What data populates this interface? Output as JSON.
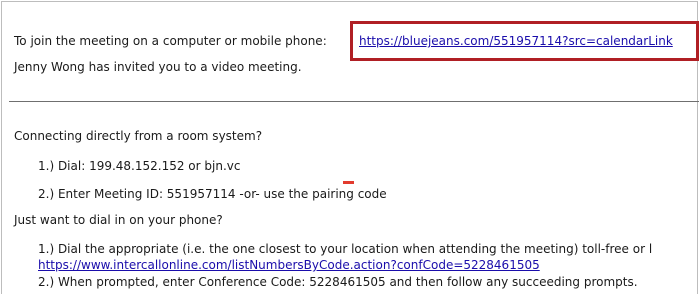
{
  "email": {
    "join_text": "To join the meeting on a computer or mobile phone:",
    "join_link": "https://bluejeans.com/551957114?src=calendarLink",
    "invite_text": "Jenny Wong has invited you to a video meeting.",
    "room_heading": "Connecting directly from a room system?",
    "room_step1": "1.) Dial: 199.48.152.152 or bjn.vc",
    "room_step2": "2.) Enter Meeting ID: 551957114 -or- use the pairing code",
    "phone_heading": "Just want to dial in on your phone?",
    "phone_step1": "1.) Dial the appropriate (i.e. the one closest to your location when attending the meeting) toll-free or l",
    "phone_link": "https://www.intercallonline.com/listNumbersByCode.action?confCode=5228461505",
    "phone_step2": "2.) When prompted, enter Conference Code: 5228461505 and then follow any succeeding prompts."
  },
  "colors": {
    "highlight_border": "#b01f24",
    "link": "#1a0dab",
    "caret_mark": "#e23b2e"
  }
}
